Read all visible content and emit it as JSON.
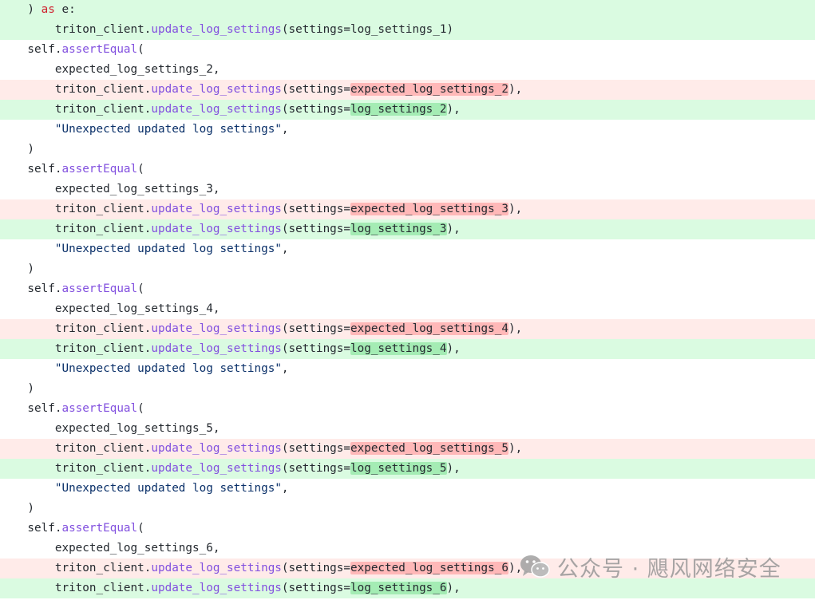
{
  "colors": {
    "added_bg": "#dafbe1",
    "removed_bg": "#ffebe9",
    "added_highlight": "#a4ecb4",
    "removed_highlight": "#ffb8b8",
    "keyword": "#cf222e",
    "function": "#8250df",
    "string": "#0a3069",
    "text": "#24292f"
  },
  "diff_lines": [
    {
      "type": "add",
      "tokens": [
        {
          "t": "    ) ",
          "c": "plain"
        },
        {
          "t": "as",
          "c": "kw"
        },
        {
          "t": " e:",
          "c": "plain"
        }
      ]
    },
    {
      "type": "add",
      "tokens": [
        {
          "t": "        triton_client.",
          "c": "plain"
        },
        {
          "t": "update_log_settings",
          "c": "fn"
        },
        {
          "t": "(settings=log_settings_1)",
          "c": "plain"
        }
      ]
    },
    {
      "type": "ctx",
      "tokens": [
        {
          "t": "    self.",
          "c": "plain"
        },
        {
          "t": "assertEqual",
          "c": "fn"
        },
        {
          "t": "(",
          "c": "plain"
        }
      ]
    },
    {
      "type": "ctx",
      "tokens": [
        {
          "t": "        expected_log_settings_2,",
          "c": "plain"
        }
      ]
    },
    {
      "type": "del",
      "tokens": [
        {
          "t": "        triton_client.",
          "c": "plain"
        },
        {
          "t": "update_log_settings",
          "c": "fn"
        },
        {
          "t": "(settings=",
          "c": "plain"
        },
        {
          "t": "expected_log_settings_2",
          "c": "plain",
          "hl": "del"
        },
        {
          "t": "),",
          "c": "plain"
        }
      ]
    },
    {
      "type": "add",
      "tokens": [
        {
          "t": "        triton_client.",
          "c": "plain"
        },
        {
          "t": "update_log_settings",
          "c": "fn"
        },
        {
          "t": "(settings=",
          "c": "plain"
        },
        {
          "t": "log_settings_2",
          "c": "plain",
          "hl": "add"
        },
        {
          "t": "),",
          "c": "plain"
        }
      ]
    },
    {
      "type": "ctx",
      "tokens": [
        {
          "t": "        ",
          "c": "plain"
        },
        {
          "t": "\"Unexpected updated log settings\"",
          "c": "str"
        },
        {
          "t": ",",
          "c": "plain"
        }
      ]
    },
    {
      "type": "ctx",
      "tokens": [
        {
          "t": "    )",
          "c": "plain"
        }
      ]
    },
    {
      "type": "ctx",
      "tokens": [
        {
          "t": "    self.",
          "c": "plain"
        },
        {
          "t": "assertEqual",
          "c": "fn"
        },
        {
          "t": "(",
          "c": "plain"
        }
      ]
    },
    {
      "type": "ctx",
      "tokens": [
        {
          "t": "        expected_log_settings_3,",
          "c": "plain"
        }
      ]
    },
    {
      "type": "del",
      "tokens": [
        {
          "t": "        triton_client.",
          "c": "plain"
        },
        {
          "t": "update_log_settings",
          "c": "fn"
        },
        {
          "t": "(settings=",
          "c": "plain"
        },
        {
          "t": "expected_log_settings_3",
          "c": "plain",
          "hl": "del"
        },
        {
          "t": "),",
          "c": "plain"
        }
      ]
    },
    {
      "type": "add",
      "tokens": [
        {
          "t": "        triton_client.",
          "c": "plain"
        },
        {
          "t": "update_log_settings",
          "c": "fn"
        },
        {
          "t": "(settings=",
          "c": "plain"
        },
        {
          "t": "log_settings_3",
          "c": "plain",
          "hl": "add"
        },
        {
          "t": "),",
          "c": "plain"
        }
      ]
    },
    {
      "type": "ctx",
      "tokens": [
        {
          "t": "        ",
          "c": "plain"
        },
        {
          "t": "\"Unexpected updated log settings\"",
          "c": "str"
        },
        {
          "t": ",",
          "c": "plain"
        }
      ]
    },
    {
      "type": "ctx",
      "tokens": [
        {
          "t": "    )",
          "c": "plain"
        }
      ]
    },
    {
      "type": "ctx",
      "tokens": [
        {
          "t": "    self.",
          "c": "plain"
        },
        {
          "t": "assertEqual",
          "c": "fn"
        },
        {
          "t": "(",
          "c": "plain"
        }
      ]
    },
    {
      "type": "ctx",
      "tokens": [
        {
          "t": "        expected_log_settings_4,",
          "c": "plain"
        }
      ]
    },
    {
      "type": "del",
      "tokens": [
        {
          "t": "        triton_client.",
          "c": "plain"
        },
        {
          "t": "update_log_settings",
          "c": "fn"
        },
        {
          "t": "(settings=",
          "c": "plain"
        },
        {
          "t": "expected_log_settings_4",
          "c": "plain",
          "hl": "del"
        },
        {
          "t": "),",
          "c": "plain"
        }
      ]
    },
    {
      "type": "add",
      "tokens": [
        {
          "t": "        triton_client.",
          "c": "plain"
        },
        {
          "t": "update_log_settings",
          "c": "fn"
        },
        {
          "t": "(settings=",
          "c": "plain"
        },
        {
          "t": "log_settings_4",
          "c": "plain",
          "hl": "add"
        },
        {
          "t": "),",
          "c": "plain"
        }
      ]
    },
    {
      "type": "ctx",
      "tokens": [
        {
          "t": "        ",
          "c": "plain"
        },
        {
          "t": "\"Unexpected updated log settings\"",
          "c": "str"
        },
        {
          "t": ",",
          "c": "plain"
        }
      ]
    },
    {
      "type": "ctx",
      "tokens": [
        {
          "t": "    )",
          "c": "plain"
        }
      ]
    },
    {
      "type": "ctx",
      "tokens": [
        {
          "t": "    self.",
          "c": "plain"
        },
        {
          "t": "assertEqual",
          "c": "fn"
        },
        {
          "t": "(",
          "c": "plain"
        }
      ]
    },
    {
      "type": "ctx",
      "tokens": [
        {
          "t": "        expected_log_settings_5,",
          "c": "plain"
        }
      ]
    },
    {
      "type": "del",
      "tokens": [
        {
          "t": "        triton_client.",
          "c": "plain"
        },
        {
          "t": "update_log_settings",
          "c": "fn"
        },
        {
          "t": "(settings=",
          "c": "plain"
        },
        {
          "t": "expected_log_settings_5",
          "c": "plain",
          "hl": "del"
        },
        {
          "t": "),",
          "c": "plain"
        }
      ]
    },
    {
      "type": "add",
      "tokens": [
        {
          "t": "        triton_client.",
          "c": "plain"
        },
        {
          "t": "update_log_settings",
          "c": "fn"
        },
        {
          "t": "(settings=",
          "c": "plain"
        },
        {
          "t": "log_settings_5",
          "c": "plain",
          "hl": "add"
        },
        {
          "t": "),",
          "c": "plain"
        }
      ]
    },
    {
      "type": "ctx",
      "tokens": [
        {
          "t": "        ",
          "c": "plain"
        },
        {
          "t": "\"Unexpected updated log settings\"",
          "c": "str"
        },
        {
          "t": ",",
          "c": "plain"
        }
      ]
    },
    {
      "type": "ctx",
      "tokens": [
        {
          "t": "    )",
          "c": "plain"
        }
      ]
    },
    {
      "type": "ctx",
      "tokens": [
        {
          "t": "    self.",
          "c": "plain"
        },
        {
          "t": "assertEqual",
          "c": "fn"
        },
        {
          "t": "(",
          "c": "plain"
        }
      ]
    },
    {
      "type": "ctx",
      "tokens": [
        {
          "t": "        expected_log_settings_6,",
          "c": "plain"
        }
      ]
    },
    {
      "type": "del",
      "tokens": [
        {
          "t": "        triton_client.",
          "c": "plain"
        },
        {
          "t": "update_log_settings",
          "c": "fn"
        },
        {
          "t": "(settings=",
          "c": "plain"
        },
        {
          "t": "expected_log_settings_6",
          "c": "plain",
          "hl": "del"
        },
        {
          "t": "),",
          "c": "plain"
        }
      ]
    },
    {
      "type": "add",
      "tokens": [
        {
          "t": "        triton_client.",
          "c": "plain"
        },
        {
          "t": "update_log_settings",
          "c": "fn"
        },
        {
          "t": "(settings=",
          "c": "plain"
        },
        {
          "t": "log_settings_6",
          "c": "plain",
          "hl": "add"
        },
        {
          "t": "),",
          "c": "plain"
        }
      ]
    }
  ],
  "watermark": {
    "text": "公众号 · 飓风网络安全",
    "icon": "wechat-logo-icon"
  }
}
